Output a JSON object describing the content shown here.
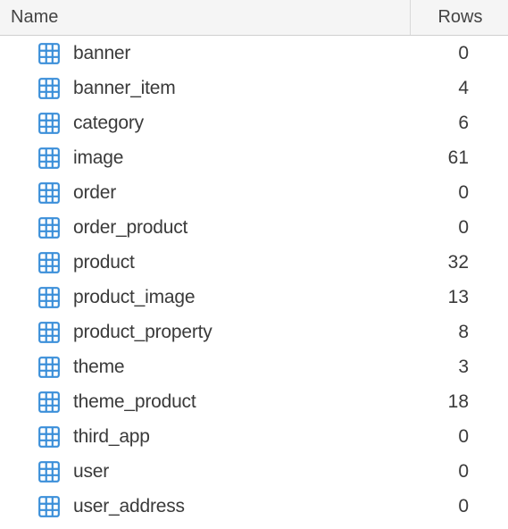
{
  "header": {
    "name_label": "Name",
    "rows_label": "Rows"
  },
  "tables": [
    {
      "name": "banner",
      "rows": 0
    },
    {
      "name": "banner_item",
      "rows": 4
    },
    {
      "name": "category",
      "rows": 6
    },
    {
      "name": "image",
      "rows": 61
    },
    {
      "name": "order",
      "rows": 0
    },
    {
      "name": "order_product",
      "rows": 0
    },
    {
      "name": "product",
      "rows": 32
    },
    {
      "name": "product_image",
      "rows": 13
    },
    {
      "name": "product_property",
      "rows": 8
    },
    {
      "name": "theme",
      "rows": 3
    },
    {
      "name": "theme_product",
      "rows": 18
    },
    {
      "name": "third_app",
      "rows": 0
    },
    {
      "name": "user",
      "rows": 0
    },
    {
      "name": "user_address",
      "rows": 0
    }
  ]
}
